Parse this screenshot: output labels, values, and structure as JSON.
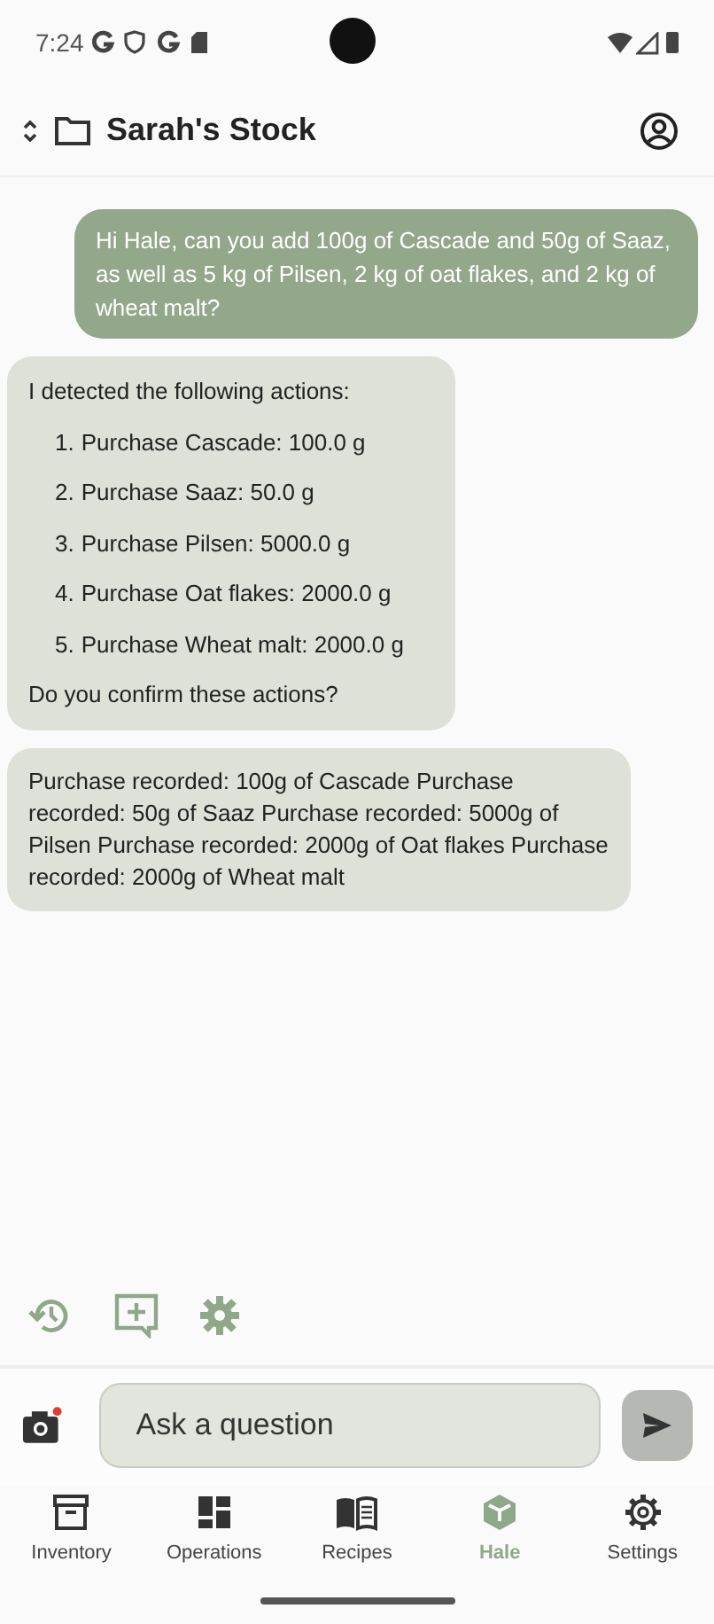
{
  "status_bar": {
    "time": "7:24"
  },
  "app_bar": {
    "title": "Sarah's Stock"
  },
  "messages": [
    {
      "kind": "user",
      "text": "Hi Hale, can you add 100g of Cascade and 50g of Saaz, as well as 5 kg of Pilsen, 2 kg of oat flakes, and 2 kg of wheat malt?"
    },
    {
      "kind": "actions",
      "intro": "I detected the following actions:",
      "items": [
        {
          "number": "1.",
          "text": "Purchase Cascade: 100.0 g"
        },
        {
          "number": "2.",
          "text": "Purchase Saaz: 50.0 g"
        },
        {
          "number": "3.",
          "text": "Purchase Pilsen: 5000.0 g"
        },
        {
          "number": "4.",
          "text": "Purchase Oat flakes: 2000.0 g"
        },
        {
          "number": "5.",
          "text": "Purchase Wheat malt: 2000.0 g"
        }
      ],
      "outro": "Do you confirm these actions?"
    },
    {
      "kind": "bot",
      "text": "Purchase recorded: 100g of Cascade Purchase recorded: 50g of Saaz Purchase recorded: 5000g of Pilsen Purchase recorded: 2000g of Oat flakes Purchase recorded: 2000g of Wheat malt"
    }
  ],
  "input": {
    "placeholder": "Ask a question"
  },
  "nav": [
    {
      "kind": "inventory",
      "label": "Inventory",
      "selected": false
    },
    {
      "kind": "operations",
      "label": "Operations",
      "selected": false
    },
    {
      "kind": "recipes",
      "label": "Recipes",
      "selected": false
    },
    {
      "kind": "hale",
      "label": "Hale",
      "selected": true
    },
    {
      "kind": "settings",
      "label": "Settings",
      "selected": false
    }
  ]
}
